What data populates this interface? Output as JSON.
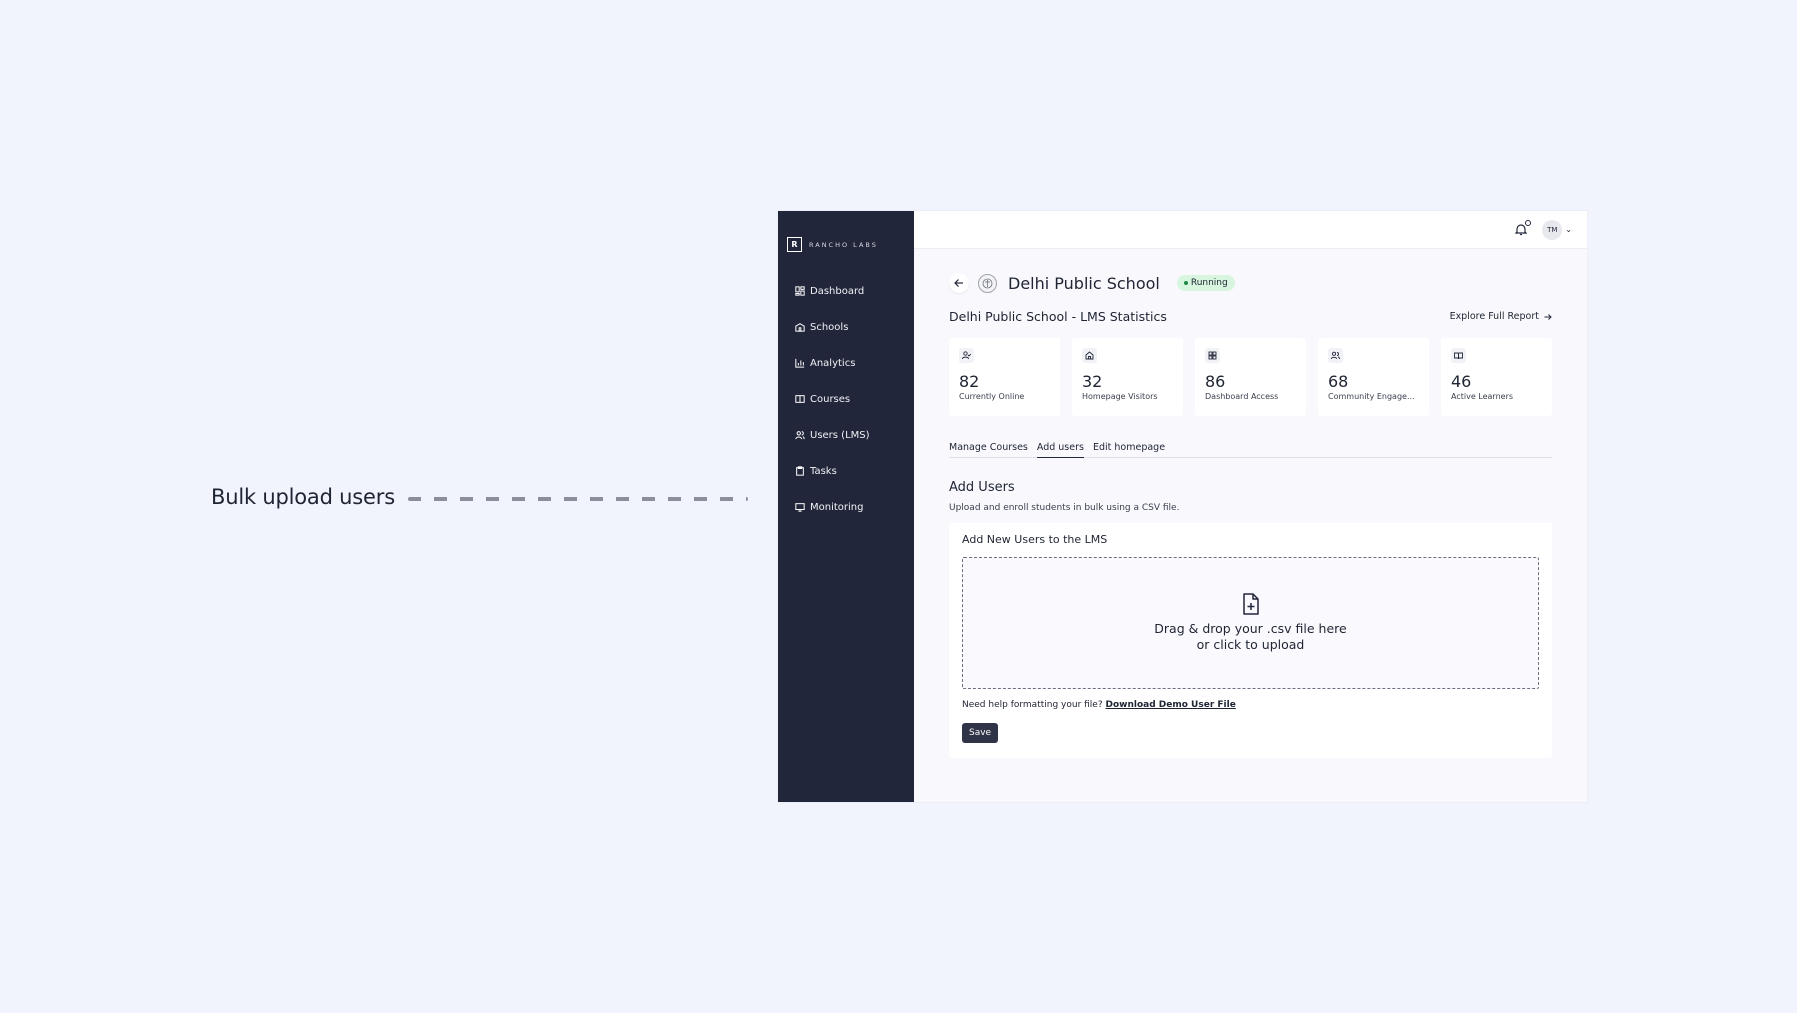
{
  "callout": {
    "label": "Bulk upload users"
  },
  "brand": {
    "name": "RANCHO LABS"
  },
  "sidebar": {
    "items": [
      {
        "label": "Dashboard",
        "icon": "dashboard-icon"
      },
      {
        "label": "Schools",
        "icon": "school-icon"
      },
      {
        "label": "Analytics",
        "icon": "analytics-icon"
      },
      {
        "label": "Courses",
        "icon": "book-icon"
      },
      {
        "label": "Users (LMS)",
        "icon": "users-icon"
      },
      {
        "label": "Tasks",
        "icon": "clipboard-icon"
      },
      {
        "label": "Monitoring",
        "icon": "monitor-icon"
      }
    ]
  },
  "topbar": {
    "avatar_initials": "TM"
  },
  "header": {
    "school_name": "Delhi Public School",
    "status": "Running",
    "status_color": "#d7f5df"
  },
  "stats": {
    "title": "Delhi Public School - LMS Statistics",
    "explore_label": "Explore Full Report",
    "cards": [
      {
        "value": "82",
        "label": "Currently Online",
        "icon": "user-check-icon"
      },
      {
        "value": "32",
        "label": "Homepage Visitors",
        "icon": "home-icon"
      },
      {
        "value": "86",
        "label": "Dashboard Access",
        "icon": "grid-icon"
      },
      {
        "value": "68",
        "label": "Community Engage...",
        "icon": "users-icon"
      },
      {
        "value": "46",
        "label": "Active Learners",
        "icon": "open-book-icon"
      }
    ]
  },
  "tabs": [
    {
      "label": "Manage Courses",
      "active": false
    },
    {
      "label": "Add users",
      "active": true
    },
    {
      "label": "Edit homepage",
      "active": false
    }
  ],
  "add_users": {
    "title": "Add Users",
    "subtitle": "Upload and enroll students in bulk using a CSV file.",
    "card_title": "Add New Users to the LMS",
    "dropzone_line1": "Drag & drop your .csv file here",
    "dropzone_line2": "or click to upload",
    "help_text": "Need help formatting your file?",
    "help_link": "Download Demo User File",
    "save_label": "Save"
  }
}
